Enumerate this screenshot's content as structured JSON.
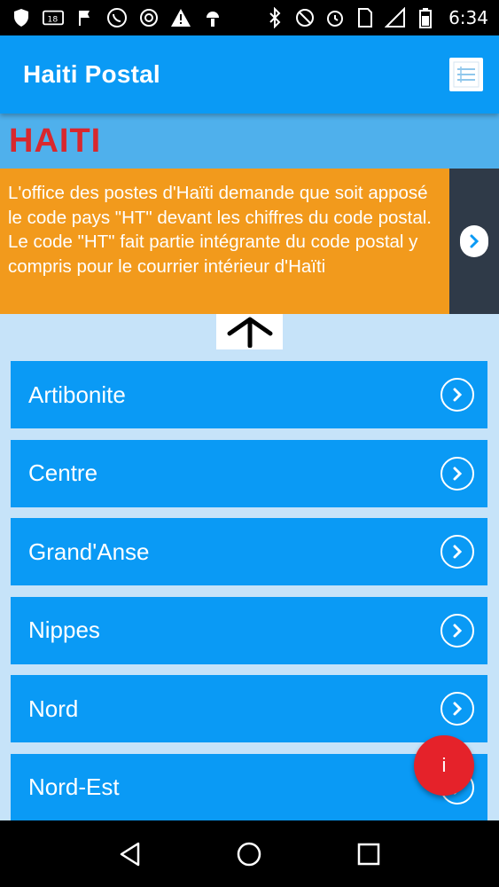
{
  "status_bar": {
    "time": "6:34",
    "icons": [
      "shield-icon",
      "picture-icon",
      "flag-icon",
      "whatsapp-icon",
      "tools-icon",
      "warning-icon",
      "android-icon",
      "bluetooth-icon",
      "do-not-disturb-icon",
      "alarm-icon",
      "sim-icon",
      "signal-icon",
      "battery-icon"
    ]
  },
  "app_bar": {
    "title": "Haiti Postal",
    "menu_icon": "list-menu-icon"
  },
  "country": {
    "title": "HAITI"
  },
  "notice": {
    "text": "L'office des postes d'Haïti demande que soit apposé le code pays \"HT\" devant les chiffres du code postal. Le code \"HT\" fait partie intégrante du code postal y compris pour le courrier intérieur d'Haïti"
  },
  "regions": [
    {
      "label": "Artibonite"
    },
    {
      "label": "Centre"
    },
    {
      "label": "Grand'Anse"
    },
    {
      "label": "Nippes"
    },
    {
      "label": "Nord"
    },
    {
      "label": "Nord-Est"
    }
  ],
  "fab": {
    "label": "i"
  },
  "colors": {
    "primary": "#0a9af5",
    "accent": "#f29a1c",
    "fab": "#e5222a",
    "country_title": "#d8282e",
    "background": "#c6e3f9"
  }
}
